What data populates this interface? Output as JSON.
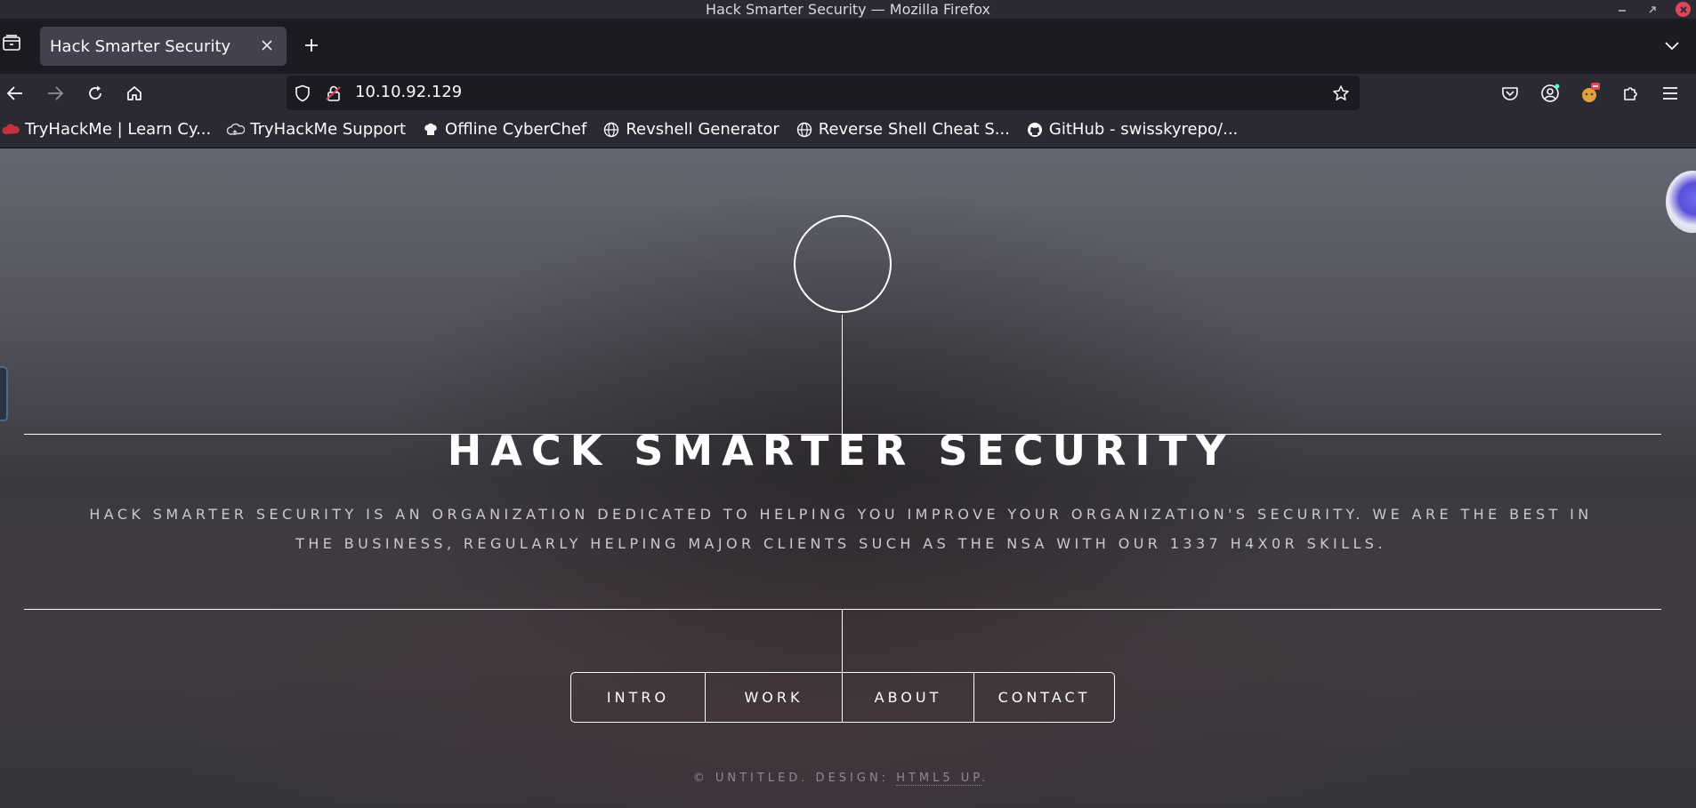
{
  "window": {
    "title": "Hack Smarter Security — Mozilla Firefox"
  },
  "tabs": [
    {
      "label": "Hack Smarter Security"
    }
  ],
  "navbar": {
    "url": "10.10.92.129"
  },
  "bookmarks": [
    {
      "label": "TryHackMe | Learn Cy...",
      "icon": "tryhackme-icon"
    },
    {
      "label": "TryHackMe Support",
      "icon": "cloud-icon"
    },
    {
      "label": "Offline CyberChef",
      "icon": "chef-icon"
    },
    {
      "label": "Revshell Generator",
      "icon": "globe-icon"
    },
    {
      "label": "Reverse Shell Cheat S...",
      "icon": "globe-icon"
    },
    {
      "label": "GitHub - swisskyrepo/...",
      "icon": "github-icon"
    }
  ],
  "site": {
    "title": "HACK SMARTER SECURITY",
    "description": "Hack Smarter Security is an organization dedicated to helping you improve your organization's security. We are the best in the business, regularly helping major clients such as the NSA with our 1337 H4X0R skills.",
    "nav": [
      "INTRO",
      "WORK",
      "ABOUT",
      "CONTACT"
    ],
    "footer_prefix": "© UNTITLED. DESIGN:",
    "footer_link": "HTML5 UP",
    "footer_suffix": "."
  },
  "colors": {
    "chrome_dark": "#1c1b22",
    "chrome_toolbar": "#2b2a33",
    "tab_active": "#42414d",
    "text": "#fbfbfe"
  }
}
